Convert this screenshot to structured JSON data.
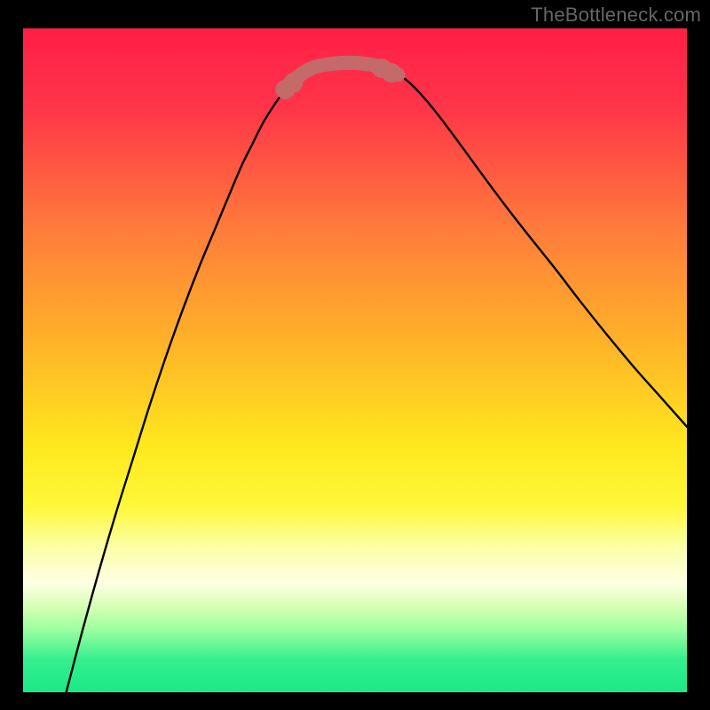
{
  "attribution": "TheBottleneck.com",
  "colors": {
    "gradient_stops": [
      {
        "offset": 0,
        "color": "#ff1f46"
      },
      {
        "offset": 0.12,
        "color": "#ff3549"
      },
      {
        "offset": 0.3,
        "color": "#ff7b3b"
      },
      {
        "offset": 0.48,
        "color": "#ffb528"
      },
      {
        "offset": 0.63,
        "color": "#ffe81e"
      },
      {
        "offset": 0.72,
        "color": "#fff83a"
      },
      {
        "offset": 0.78,
        "color": "#fbffa4"
      },
      {
        "offset": 0.835,
        "color": "#feffe4"
      },
      {
        "offset": 0.87,
        "color": "#d7ffb6"
      },
      {
        "offset": 0.905,
        "color": "#9dffa0"
      },
      {
        "offset": 0.95,
        "color": "#36ef8f"
      },
      {
        "offset": 1.0,
        "color": "#1ae887"
      }
    ],
    "curve": "#000000",
    "tip_accent": "#c46a69"
  },
  "chart_data": {
    "type": "line",
    "title": "",
    "xlabel": "",
    "ylabel": "",
    "xlim": [
      0,
      1
    ],
    "ylim": [
      0,
      1
    ],
    "series": [
      {
        "name": "bottleneck-curve",
        "x": [
          0.065,
          0.09,
          0.115,
          0.14,
          0.165,
          0.19,
          0.215,
          0.24,
          0.265,
          0.29,
          0.315,
          0.33,
          0.345,
          0.36,
          0.372,
          0.384,
          0.395,
          0.405,
          0.415,
          0.425,
          0.44,
          0.46,
          0.48,
          0.5,
          0.52,
          0.535,
          0.55,
          0.565,
          0.58,
          0.6,
          0.625,
          0.655,
          0.69,
          0.725,
          0.76,
          0.8,
          0.84,
          0.88,
          0.92,
          0.96,
          1.0
        ],
        "y": [
          0.0,
          0.095,
          0.185,
          0.27,
          0.35,
          0.43,
          0.505,
          0.575,
          0.64,
          0.7,
          0.76,
          0.795,
          0.825,
          0.855,
          0.875,
          0.893,
          0.908,
          0.92,
          0.928,
          0.935,
          0.942,
          0.946,
          0.948,
          0.948,
          0.946,
          0.943,
          0.938,
          0.93,
          0.92,
          0.9,
          0.87,
          0.83,
          0.782,
          0.735,
          0.69,
          0.64,
          0.588,
          0.538,
          0.49,
          0.445,
          0.4
        ]
      }
    ],
    "tip_highlight": {
      "x_range": [
        0.395,
        0.565
      ],
      "dots_x": [
        0.395,
        0.407,
        0.54,
        0.555
      ],
      "dots_y": [
        0.908,
        0.918,
        0.94,
        0.933
      ]
    }
  }
}
